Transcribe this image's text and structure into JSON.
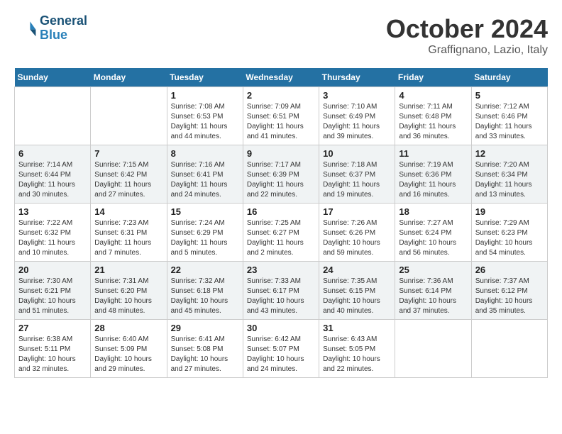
{
  "header": {
    "logo_line1": "General",
    "logo_line2": "Blue",
    "month": "October 2024",
    "location": "Graffignano, Lazio, Italy"
  },
  "days_of_week": [
    "Sunday",
    "Monday",
    "Tuesday",
    "Wednesday",
    "Thursday",
    "Friday",
    "Saturday"
  ],
  "weeks": [
    [
      {
        "num": "",
        "info": ""
      },
      {
        "num": "",
        "info": ""
      },
      {
        "num": "1",
        "info": "Sunrise: 7:08 AM\nSunset: 6:53 PM\nDaylight: 11 hours and 44 minutes."
      },
      {
        "num": "2",
        "info": "Sunrise: 7:09 AM\nSunset: 6:51 PM\nDaylight: 11 hours and 41 minutes."
      },
      {
        "num": "3",
        "info": "Sunrise: 7:10 AM\nSunset: 6:49 PM\nDaylight: 11 hours and 39 minutes."
      },
      {
        "num": "4",
        "info": "Sunrise: 7:11 AM\nSunset: 6:48 PM\nDaylight: 11 hours and 36 minutes."
      },
      {
        "num": "5",
        "info": "Sunrise: 7:12 AM\nSunset: 6:46 PM\nDaylight: 11 hours and 33 minutes."
      }
    ],
    [
      {
        "num": "6",
        "info": "Sunrise: 7:14 AM\nSunset: 6:44 PM\nDaylight: 11 hours and 30 minutes."
      },
      {
        "num": "7",
        "info": "Sunrise: 7:15 AM\nSunset: 6:42 PM\nDaylight: 11 hours and 27 minutes."
      },
      {
        "num": "8",
        "info": "Sunrise: 7:16 AM\nSunset: 6:41 PM\nDaylight: 11 hours and 24 minutes."
      },
      {
        "num": "9",
        "info": "Sunrise: 7:17 AM\nSunset: 6:39 PM\nDaylight: 11 hours and 22 minutes."
      },
      {
        "num": "10",
        "info": "Sunrise: 7:18 AM\nSunset: 6:37 PM\nDaylight: 11 hours and 19 minutes."
      },
      {
        "num": "11",
        "info": "Sunrise: 7:19 AM\nSunset: 6:36 PM\nDaylight: 11 hours and 16 minutes."
      },
      {
        "num": "12",
        "info": "Sunrise: 7:20 AM\nSunset: 6:34 PM\nDaylight: 11 hours and 13 minutes."
      }
    ],
    [
      {
        "num": "13",
        "info": "Sunrise: 7:22 AM\nSunset: 6:32 PM\nDaylight: 11 hours and 10 minutes."
      },
      {
        "num": "14",
        "info": "Sunrise: 7:23 AM\nSunset: 6:31 PM\nDaylight: 11 hours and 7 minutes."
      },
      {
        "num": "15",
        "info": "Sunrise: 7:24 AM\nSunset: 6:29 PM\nDaylight: 11 hours and 5 minutes."
      },
      {
        "num": "16",
        "info": "Sunrise: 7:25 AM\nSunset: 6:27 PM\nDaylight: 11 hours and 2 minutes."
      },
      {
        "num": "17",
        "info": "Sunrise: 7:26 AM\nSunset: 6:26 PM\nDaylight: 10 hours and 59 minutes."
      },
      {
        "num": "18",
        "info": "Sunrise: 7:27 AM\nSunset: 6:24 PM\nDaylight: 10 hours and 56 minutes."
      },
      {
        "num": "19",
        "info": "Sunrise: 7:29 AM\nSunset: 6:23 PM\nDaylight: 10 hours and 54 minutes."
      }
    ],
    [
      {
        "num": "20",
        "info": "Sunrise: 7:30 AM\nSunset: 6:21 PM\nDaylight: 10 hours and 51 minutes."
      },
      {
        "num": "21",
        "info": "Sunrise: 7:31 AM\nSunset: 6:20 PM\nDaylight: 10 hours and 48 minutes."
      },
      {
        "num": "22",
        "info": "Sunrise: 7:32 AM\nSunset: 6:18 PM\nDaylight: 10 hours and 45 minutes."
      },
      {
        "num": "23",
        "info": "Sunrise: 7:33 AM\nSunset: 6:17 PM\nDaylight: 10 hours and 43 minutes."
      },
      {
        "num": "24",
        "info": "Sunrise: 7:35 AM\nSunset: 6:15 PM\nDaylight: 10 hours and 40 minutes."
      },
      {
        "num": "25",
        "info": "Sunrise: 7:36 AM\nSunset: 6:14 PM\nDaylight: 10 hours and 37 minutes."
      },
      {
        "num": "26",
        "info": "Sunrise: 7:37 AM\nSunset: 6:12 PM\nDaylight: 10 hours and 35 minutes."
      }
    ],
    [
      {
        "num": "27",
        "info": "Sunrise: 6:38 AM\nSunset: 5:11 PM\nDaylight: 10 hours and 32 minutes."
      },
      {
        "num": "28",
        "info": "Sunrise: 6:40 AM\nSunset: 5:09 PM\nDaylight: 10 hours and 29 minutes."
      },
      {
        "num": "29",
        "info": "Sunrise: 6:41 AM\nSunset: 5:08 PM\nDaylight: 10 hours and 27 minutes."
      },
      {
        "num": "30",
        "info": "Sunrise: 6:42 AM\nSunset: 5:07 PM\nDaylight: 10 hours and 24 minutes."
      },
      {
        "num": "31",
        "info": "Sunrise: 6:43 AM\nSunset: 5:05 PM\nDaylight: 10 hours and 22 minutes."
      },
      {
        "num": "",
        "info": ""
      },
      {
        "num": "",
        "info": ""
      }
    ]
  ]
}
